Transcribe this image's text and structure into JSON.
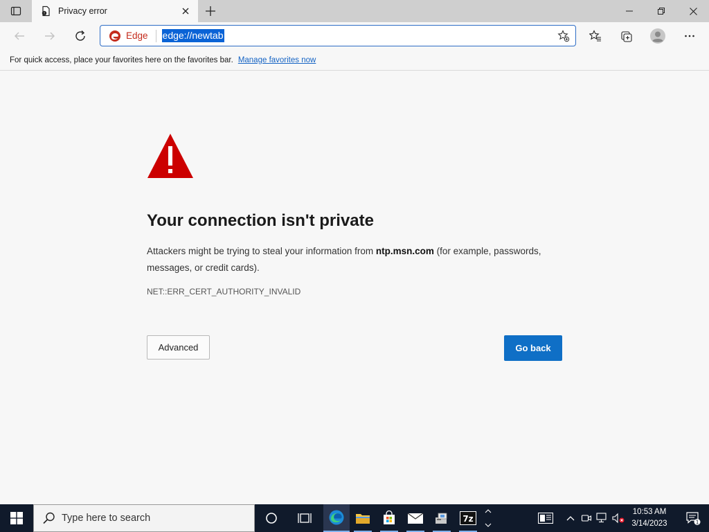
{
  "tab": {
    "title": "Privacy error"
  },
  "toolbar": {
    "site_label": "Edge",
    "url": "edge://newtab"
  },
  "favorites_bar": {
    "text": "For quick access, place your favorites here on the favorites bar.",
    "link": "Manage favorites now"
  },
  "error": {
    "title": "Your connection isn't private",
    "desc_before": "Attackers might be trying to steal your information from ",
    "host": "ntp.msn.com",
    "desc_after": " (for example, passwords, messages, or credit cards).",
    "code": "NET::ERR_CERT_AUTHORITY_INVALID",
    "advanced_label": "Advanced",
    "go_back_label": "Go back"
  },
  "taskbar": {
    "search_placeholder": "Type here to search",
    "time": "10:53 AM",
    "date": "3/14/2023",
    "notification_count": "1"
  },
  "colors": {
    "accent": "#0f6fc6",
    "warning": "#cc0000",
    "edge_red": "#c42b1c"
  }
}
